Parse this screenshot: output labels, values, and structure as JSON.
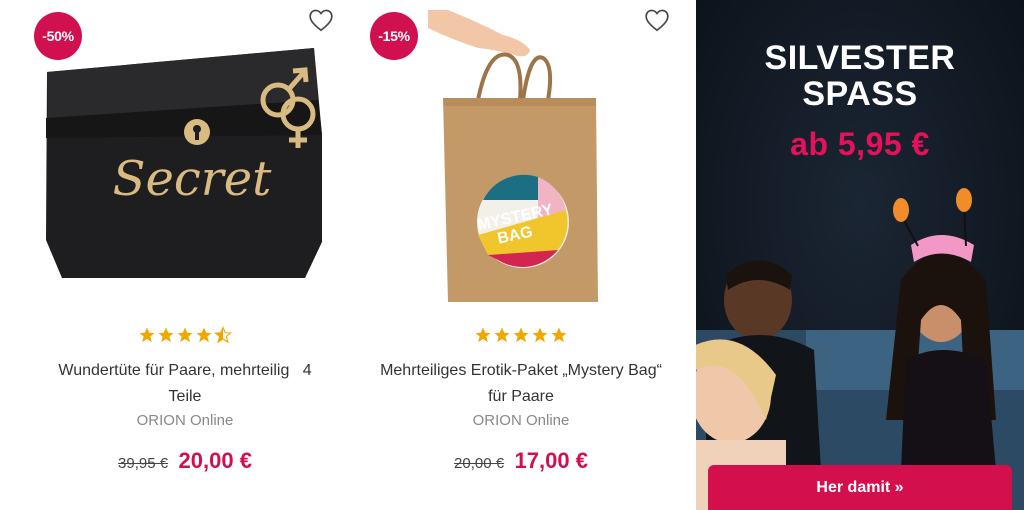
{
  "products": [
    {
      "discount": "-50%",
      "rating": 4.5,
      "title_line1": "Wundertüte für Paare, mehrteilig",
      "title_extra": "4",
      "title_line2": "Teile",
      "brand": "ORION Online",
      "old_price": "39,95 €",
      "new_price": "20,00 €",
      "image_text": "Secret"
    },
    {
      "discount": "-15%",
      "rating": 5,
      "title_line1": "Mehrteiliges Erotik-Paket „Mystery Bag“",
      "title_line2": "für Paare",
      "brand": "ORION Online",
      "old_price": "20,00 €",
      "new_price": "17,00 €",
      "image_text_1": "MYSTERY",
      "image_text_2": "BAG"
    }
  ],
  "promo": {
    "title_line1": "SILVESTER",
    "title_line2": "SPASS",
    "subtitle": "ab 5,95 €",
    "button": "Her damit »"
  },
  "colors": {
    "accent": "#d0104f",
    "star": "#f0a800",
    "banner_bg": "#101722"
  },
  "icons": [
    "heart-outline-icon",
    "star-icon"
  ]
}
